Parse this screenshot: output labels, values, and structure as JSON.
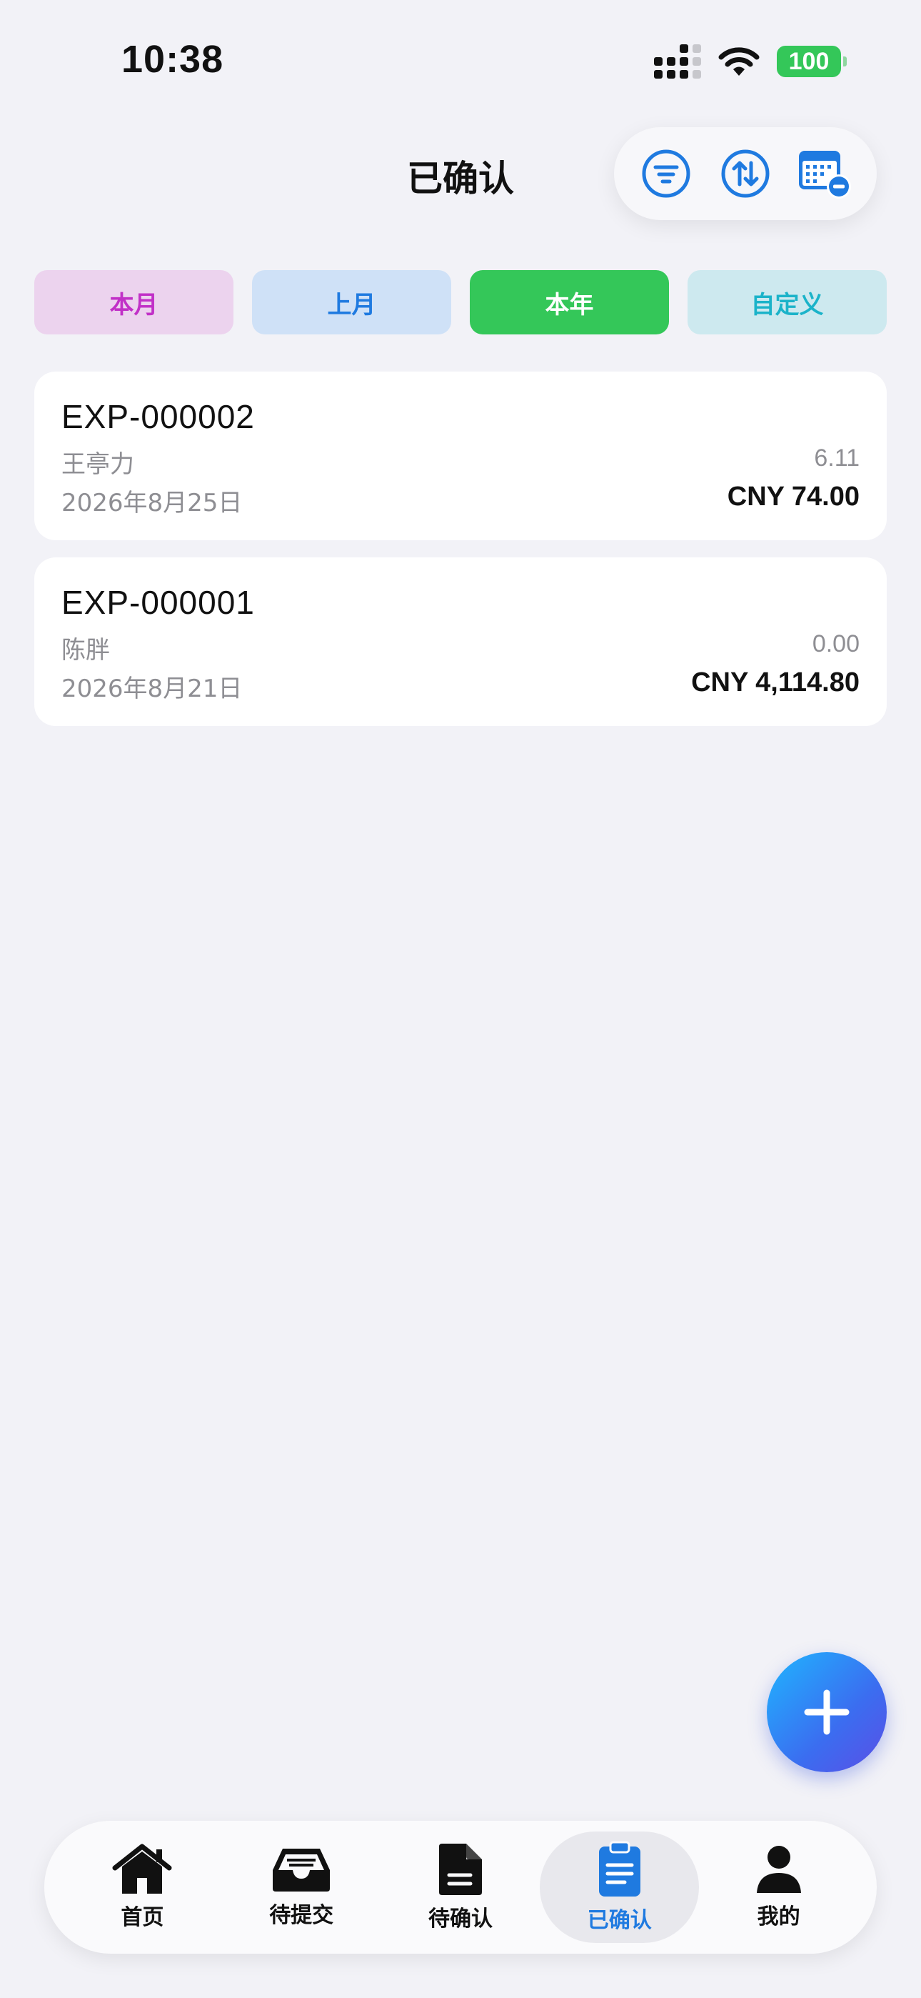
{
  "status_bar": {
    "time": "10:38",
    "battery": "100"
  },
  "header": {
    "title": "已确认"
  },
  "toolbar": {
    "icons": [
      "filter-icon",
      "sort-icon",
      "calendar-remove-icon"
    ]
  },
  "filters": [
    {
      "label": "本月",
      "selected": false
    },
    {
      "label": "上月",
      "selected": false
    },
    {
      "label": "本年",
      "selected": true
    },
    {
      "label": "自定义",
      "selected": false
    }
  ],
  "expenses": [
    {
      "id": "EXP-000002",
      "name": "王亭力",
      "date": "2026年8月25日",
      "sub_value": "6.11",
      "amount": "CNY 74.00"
    },
    {
      "id": "EXP-000001",
      "name": "陈胖",
      "date": "2026年8月21日",
      "sub_value": "0.00",
      "amount": "CNY 4,114.80"
    }
  ],
  "fab": {
    "icon": "plus-icon"
  },
  "tabbar": [
    {
      "label": "首页",
      "icon": "house-icon",
      "active": false
    },
    {
      "label": "待提交",
      "icon": "tray-icon",
      "active": false
    },
    {
      "label": "待确认",
      "icon": "document-icon",
      "active": false
    },
    {
      "label": "已确认",
      "icon": "clipboard-icon",
      "active": true
    },
    {
      "label": "我的",
      "icon": "person-icon",
      "active": false
    }
  ],
  "colors": {
    "accent": "#1f7ae0",
    "green": "#34c759",
    "background": "#f2f2f7"
  }
}
